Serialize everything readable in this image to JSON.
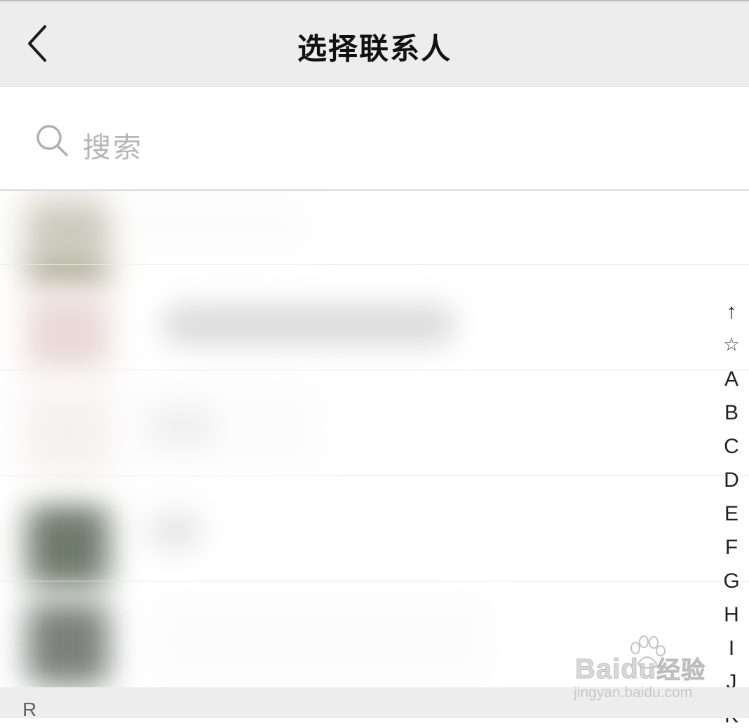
{
  "header": {
    "title": "选择联系人",
    "back_icon": "chevron-left-icon"
  },
  "search": {
    "placeholder": "搜索",
    "icon": "search-icon"
  },
  "contacts": {
    "count_visible": 5,
    "note_obscured": true
  },
  "index_bar": {
    "items": [
      "↑",
      "☆",
      "A",
      "B",
      "C",
      "D",
      "E",
      "F",
      "G",
      "H",
      "I",
      "J",
      "K"
    ]
  },
  "section": {
    "letter": "R"
  },
  "watermark": {
    "brand_a": "Bai",
    "brand_b": "du",
    "brand_c": "经验",
    "url": "jingyan.baidu.com"
  },
  "colors": {
    "header_bg": "#ededed",
    "placeholder": "#b5b5b5",
    "divider": "#e6e6e6"
  }
}
